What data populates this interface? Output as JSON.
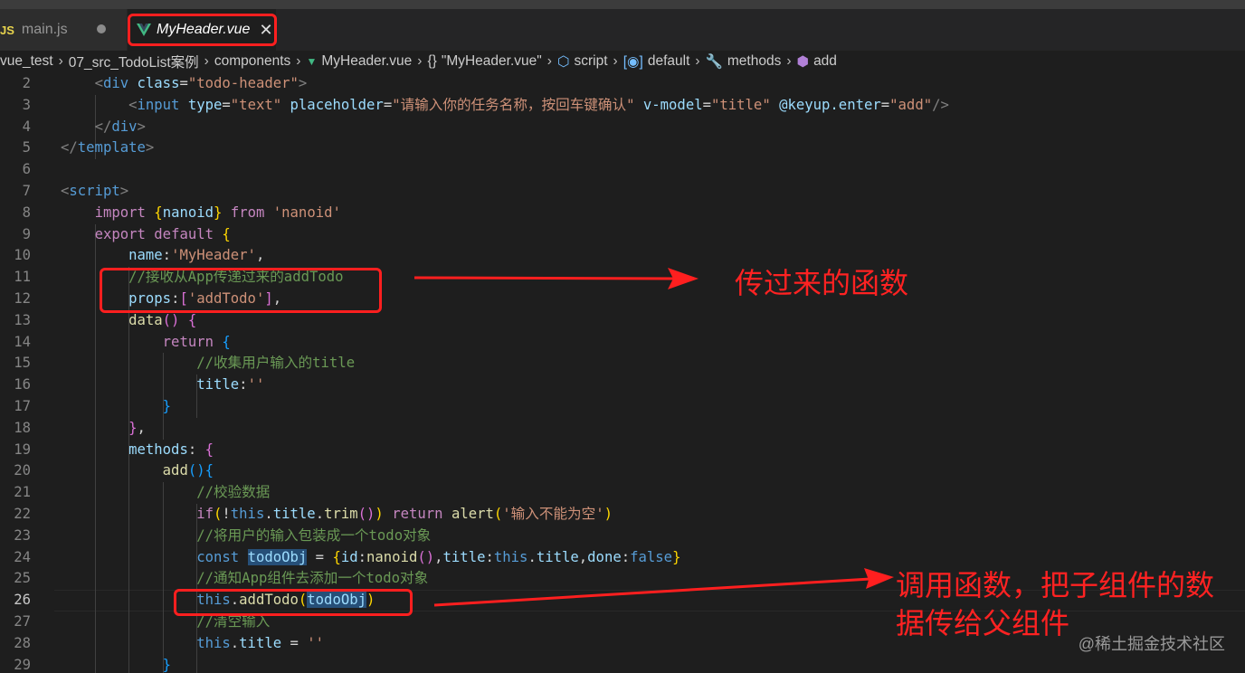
{
  "tabs": [
    {
      "icon": "JS",
      "label": "main.js"
    },
    {
      "label": "MyHeader.vue",
      "close": "✕"
    }
  ],
  "breadcrumb": [
    "vue_test",
    "07_src_TodoList案例",
    "components",
    "MyHeader.vue",
    "\"MyHeader.vue\"",
    "script",
    "default",
    "methods",
    "add"
  ],
  "breadcrumb_icons": [
    "",
    "",
    "",
    "vue-icon",
    "braces-icon",
    "script-icon",
    "module-icon",
    "wrench-icon",
    "cube-icon"
  ],
  "editor": {
    "current_line": 26,
    "lines": [
      {
        "n": "2",
        "t": [
          [
            "    ",
            "pn"
          ],
          [
            "<",
            "tg"
          ],
          [
            "div",
            "tn"
          ],
          [
            " ",
            "pn"
          ],
          [
            "class",
            "at"
          ],
          [
            "=",
            "pn"
          ],
          [
            "\"todo-header\"",
            "st"
          ],
          [
            ">",
            "tg"
          ]
        ]
      },
      {
        "n": "3",
        "t": [
          [
            "        ",
            "pn"
          ],
          [
            "<",
            "tg"
          ],
          [
            "input",
            "tn"
          ],
          [
            " ",
            "pn"
          ],
          [
            "type",
            "at"
          ],
          [
            "=",
            "pn"
          ],
          [
            "\"text\"",
            "st"
          ],
          [
            " ",
            "pn"
          ],
          [
            "placeholder",
            "at"
          ],
          [
            "=",
            "pn"
          ],
          [
            "\"请输入你的任务名称，按回车键确认\"",
            "st"
          ],
          [
            " ",
            "pn"
          ],
          [
            "v-model",
            "at"
          ],
          [
            "=",
            "pn"
          ],
          [
            "\"title\"",
            "st"
          ],
          [
            " ",
            "pn"
          ],
          [
            "@keyup.enter",
            "at"
          ],
          [
            "=",
            "pn"
          ],
          [
            "\"add\"",
            "st"
          ],
          [
            "/>",
            "tg"
          ]
        ]
      },
      {
        "n": "4",
        "t": [
          [
            "    ",
            "pn"
          ],
          [
            "</",
            "tg"
          ],
          [
            "div",
            "tn"
          ],
          [
            ">",
            "tg"
          ]
        ]
      },
      {
        "n": "5",
        "t": [
          [
            "</",
            "tg"
          ],
          [
            "template",
            "tn"
          ],
          [
            ">",
            "tg"
          ]
        ]
      },
      {
        "n": "6",
        "t": []
      },
      {
        "n": "7",
        "t": [
          [
            "<",
            "tg"
          ],
          [
            "script",
            "tn"
          ],
          [
            ">",
            "tg"
          ]
        ]
      },
      {
        "n": "8",
        "t": [
          [
            "    ",
            "pn"
          ],
          [
            "import",
            "kw"
          ],
          [
            " ",
            "pn"
          ],
          [
            "{",
            "br1"
          ],
          [
            "nanoid",
            "vr"
          ],
          [
            "}",
            "br1"
          ],
          [
            " ",
            "pn"
          ],
          [
            "from",
            "kw"
          ],
          [
            " ",
            "pn"
          ],
          [
            "'nanoid'",
            "st"
          ]
        ]
      },
      {
        "n": "9",
        "t": [
          [
            "    ",
            "pn"
          ],
          [
            "export",
            "kw"
          ],
          [
            " ",
            "pn"
          ],
          [
            "default",
            "kw"
          ],
          [
            " ",
            "pn"
          ],
          [
            "{",
            "br1"
          ]
        ]
      },
      {
        "n": "10",
        "t": [
          [
            "        ",
            "pn"
          ],
          [
            "name",
            "vr"
          ],
          [
            ":",
            "pn"
          ],
          [
            "'MyHeader'",
            "st"
          ],
          [
            ",",
            "pn"
          ]
        ]
      },
      {
        "n": "11",
        "t": [
          [
            "        ",
            "pn"
          ],
          [
            "//接收从App传递过来的addTodo",
            "cm"
          ]
        ]
      },
      {
        "n": "12",
        "t": [
          [
            "        ",
            "pn"
          ],
          [
            "props",
            "vr"
          ],
          [
            ":",
            "pn"
          ],
          [
            "[",
            "br2"
          ],
          [
            "'addTodo'",
            "st"
          ],
          [
            "]",
            "br2"
          ],
          [
            ",",
            "pn"
          ]
        ]
      },
      {
        "n": "13",
        "t": [
          [
            "        ",
            "pn"
          ],
          [
            "data",
            "fn"
          ],
          [
            "()",
            "br2"
          ],
          [
            " ",
            "pn"
          ],
          [
            "{",
            "br2"
          ]
        ]
      },
      {
        "n": "14",
        "t": [
          [
            "            ",
            "pn"
          ],
          [
            "return",
            "kw"
          ],
          [
            " ",
            "pn"
          ],
          [
            "{",
            "br3"
          ]
        ]
      },
      {
        "n": "15",
        "t": [
          [
            "                ",
            "pn"
          ],
          [
            "//收集用户输入的title",
            "cm"
          ]
        ]
      },
      {
        "n": "16",
        "t": [
          [
            "                ",
            "pn"
          ],
          [
            "title",
            "vr"
          ],
          [
            ":",
            "pn"
          ],
          [
            "''",
            "st"
          ]
        ]
      },
      {
        "n": "17",
        "t": [
          [
            "            ",
            "pn"
          ],
          [
            "}",
            "br3"
          ]
        ]
      },
      {
        "n": "18",
        "t": [
          [
            "        ",
            "pn"
          ],
          [
            "}",
            "br2"
          ],
          [
            ",",
            "pn"
          ]
        ]
      },
      {
        "n": "19",
        "t": [
          [
            "        ",
            "pn"
          ],
          [
            "methods",
            "vr"
          ],
          [
            ":",
            "pn"
          ],
          [
            " ",
            "pn"
          ],
          [
            "{",
            "br2"
          ]
        ]
      },
      {
        "n": "20",
        "t": [
          [
            "            ",
            "pn"
          ],
          [
            "add",
            "fn"
          ],
          [
            "()",
            "br3"
          ],
          [
            "{",
            "br3"
          ]
        ]
      },
      {
        "n": "21",
        "t": [
          [
            "                ",
            "pn"
          ],
          [
            "//校验数据",
            "cm"
          ]
        ]
      },
      {
        "n": "22",
        "t": [
          [
            "                ",
            "pn"
          ],
          [
            "if",
            "kw"
          ],
          [
            "(",
            "br1"
          ],
          [
            "!",
            "pn"
          ],
          [
            "this",
            "kb"
          ],
          [
            ".",
            "pn"
          ],
          [
            "title",
            "vr"
          ],
          [
            ".",
            "pn"
          ],
          [
            "trim",
            "fn"
          ],
          [
            "()",
            "br2"
          ],
          [
            ")",
            "br1"
          ],
          [
            " ",
            "pn"
          ],
          [
            "return",
            "kw"
          ],
          [
            " ",
            "pn"
          ],
          [
            "alert",
            "fn"
          ],
          [
            "(",
            "br1"
          ],
          [
            "'输入不能为空'",
            "st"
          ],
          [
            ")",
            "br1"
          ]
        ]
      },
      {
        "n": "23",
        "t": [
          [
            "                ",
            "pn"
          ],
          [
            "//将用户的输入包装成一个todo对象",
            "cm"
          ]
        ]
      },
      {
        "n": "24",
        "t": [
          [
            "                ",
            "pn"
          ],
          [
            "const",
            "kb"
          ],
          [
            " ",
            "pn"
          ],
          [
            "todoObj",
            "vr hl"
          ],
          [
            " = ",
            "pn"
          ],
          [
            "{",
            "br1"
          ],
          [
            "id",
            "vr"
          ],
          [
            ":",
            "pn"
          ],
          [
            "nanoid",
            "fn"
          ],
          [
            "()",
            "br2"
          ],
          [
            ",",
            "pn"
          ],
          [
            "title",
            "vr"
          ],
          [
            ":",
            "pn"
          ],
          [
            "this",
            "kb"
          ],
          [
            ".",
            "pn"
          ],
          [
            "title",
            "vr"
          ],
          [
            ",",
            "pn"
          ],
          [
            "done",
            "vr"
          ],
          [
            ":",
            "pn"
          ],
          [
            "false",
            "kb"
          ],
          [
            "}",
            "br1"
          ]
        ]
      },
      {
        "n": "25",
        "t": [
          [
            "                ",
            "pn"
          ],
          [
            "//通知App组件去添加一个todo对象",
            "cm"
          ]
        ]
      },
      {
        "n": "26",
        "t": [
          [
            "                ",
            "pn"
          ],
          [
            "this",
            "kb"
          ],
          [
            ".",
            "pn"
          ],
          [
            "addTodo",
            "fn"
          ],
          [
            "(",
            "br1"
          ],
          [
            "todoObj",
            "vr hl"
          ],
          [
            ")",
            "br1"
          ]
        ]
      },
      {
        "n": "27",
        "t": [
          [
            "                ",
            "pn"
          ],
          [
            "//清空输入",
            "cm"
          ]
        ]
      },
      {
        "n": "28",
        "t": [
          [
            "                ",
            "pn"
          ],
          [
            "this",
            "kb"
          ],
          [
            ".",
            "pn"
          ],
          [
            "title",
            "vr"
          ],
          [
            " = ",
            "pn"
          ],
          [
            "''",
            "st"
          ]
        ]
      },
      {
        "n": "29",
        "t": [
          [
            "            ",
            "pn"
          ],
          [
            "}",
            "br3"
          ]
        ]
      }
    ]
  },
  "annotations": {
    "props_note": "传过来的函数",
    "call_note_line1": "调用函数，把子组件的数",
    "call_note_line2": "据传给父组件",
    "color": "#ff1f1f"
  },
  "watermark": "@稀土掘金技术社区"
}
